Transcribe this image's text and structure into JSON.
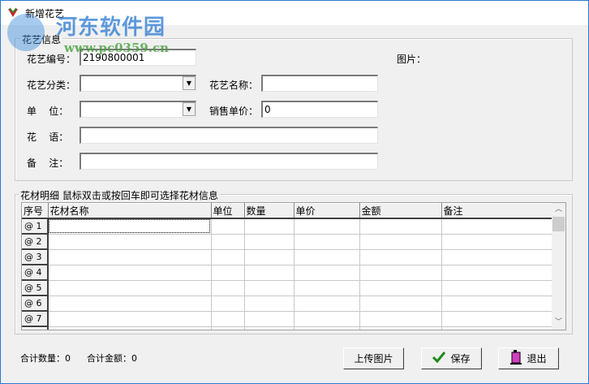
{
  "window": {
    "title": "新增花艺"
  },
  "watermark": {
    "name": "河东软件园",
    "url": "www.pc0359.cn"
  },
  "info_group": {
    "label": "花艺信息",
    "code_label": "花艺编号：",
    "code_value": "2190800001",
    "image_label": "图片：",
    "category_label": "花艺分类：",
    "category_value": "",
    "name_label": "花艺名称：",
    "name_value": "",
    "unit_label": "单    位：",
    "unit_value": "",
    "price_label": "销售单价：",
    "price_value": "0",
    "language_label": "花    语：",
    "language_value": "",
    "remark_label": "备    注：",
    "remark_value": ""
  },
  "detail_group": {
    "label": "花材明细  鼠标双击或按回车即可选择花材信息",
    "columns": [
      "序号",
      "花材名称",
      "单位",
      "数量",
      "单价",
      "金额",
      "备注"
    ],
    "rows": [
      "@ 1",
      "@ 2",
      "@ 3",
      "@ 4",
      "@ 5",
      "@ 6",
      "@ 7"
    ]
  },
  "totals": {
    "qty_label": "合计数量：",
    "qty_value": "0",
    "amount_label": "合计金额：",
    "amount_value": "0"
  },
  "buttons": {
    "upload": "上传图片",
    "save": "保存",
    "exit": "退出"
  },
  "colors": {
    "accent": "#2b79d0",
    "check": "#1a8a1a"
  }
}
